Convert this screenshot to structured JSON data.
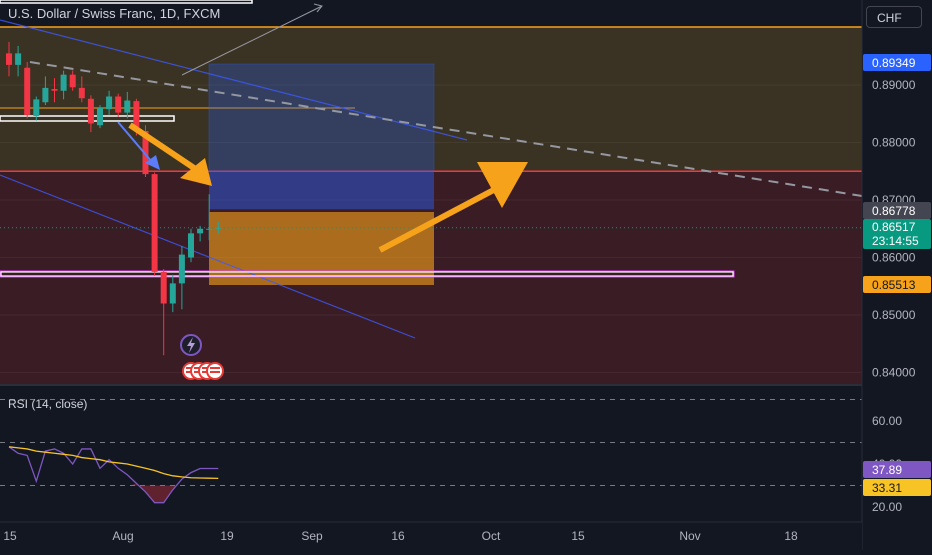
{
  "header": {
    "symbol_title": "U.S. Dollar / Swiss Franc, 1D, FXCM",
    "currency_button": "CHF"
  },
  "colors": {
    "background": "#131722",
    "upper_zone": "#3a3222",
    "lower_zone": "#3a1c24",
    "up_candle": "#26a69a",
    "down_candle": "#f23645",
    "current_price_tag": "#089981",
    "blue_tag": "#2962ff",
    "orange_tag": "#f7a21b",
    "arrow": "#f7a21b",
    "rsi_line": "#7e57c2",
    "rsi_ma": "#f7c325"
  },
  "chart_data": [
    {
      "type": "candlestick",
      "title": "U.S. Dollar / Swiss Franc, 1D, FXCM",
      "price_axis_ticks": [
        0.89,
        0.88,
        0.87,
        0.86,
        0.85,
        0.84
      ],
      "price_axis_tick_labels": [
        "0.89000",
        "0.88000",
        "0.87000",
        "0.86000",
        "0.85000",
        "0.84000"
      ],
      "ylim": [
        0.8375,
        0.9005
      ],
      "time_axis_labels": [
        "15",
        "Aug",
        "19",
        "Sep",
        "16",
        "Oct",
        "15",
        "Nov",
        "18"
      ],
      "price_tags": [
        {
          "label": "0.89349",
          "value": 0.89349,
          "color": "#2962ff"
        },
        {
          "label": "0.86778",
          "value": 0.86778,
          "color": "#434651"
        },
        {
          "label": "0.86517",
          "value": 0.86517,
          "color": "#089981",
          "countdown": "23:14:55"
        },
        {
          "label": "0.85513",
          "value": 0.85513,
          "color": "#f7a21b"
        }
      ],
      "candles": [
        {
          "o": 0.8955,
          "h": 0.8975,
          "l": 0.8915,
          "c": 0.8935
        },
        {
          "o": 0.8935,
          "h": 0.8968,
          "l": 0.8915,
          "c": 0.8955
        },
        {
          "o": 0.893,
          "h": 0.894,
          "l": 0.8842,
          "c": 0.8848
        },
        {
          "o": 0.8846,
          "h": 0.888,
          "l": 0.8838,
          "c": 0.8875
        },
        {
          "o": 0.887,
          "h": 0.8915,
          "l": 0.8865,
          "c": 0.8895
        },
        {
          "o": 0.8893,
          "h": 0.8912,
          "l": 0.887,
          "c": 0.889
        },
        {
          "o": 0.889,
          "h": 0.8925,
          "l": 0.8875,
          "c": 0.8918
        },
        {
          "o": 0.8918,
          "h": 0.8925,
          "l": 0.889,
          "c": 0.8896
        },
        {
          "o": 0.8895,
          "h": 0.8915,
          "l": 0.887,
          "c": 0.8877
        },
        {
          "o": 0.8876,
          "h": 0.8882,
          "l": 0.8818,
          "c": 0.8833
        },
        {
          "o": 0.883,
          "h": 0.8865,
          "l": 0.8825,
          "c": 0.886
        },
        {
          "o": 0.8858,
          "h": 0.889,
          "l": 0.8848,
          "c": 0.888
        },
        {
          "o": 0.888,
          "h": 0.8885,
          "l": 0.8845,
          "c": 0.8852
        },
        {
          "o": 0.8852,
          "h": 0.8888,
          "l": 0.8842,
          "c": 0.8873
        },
        {
          "o": 0.8872,
          "h": 0.8876,
          "l": 0.8812,
          "c": 0.8822
        },
        {
          "o": 0.882,
          "h": 0.883,
          "l": 0.874,
          "c": 0.8745
        },
        {
          "o": 0.8745,
          "h": 0.8748,
          "l": 0.8568,
          "c": 0.8575
        },
        {
          "o": 0.8575,
          "h": 0.858,
          "l": 0.843,
          "c": 0.852
        },
        {
          "o": 0.852,
          "h": 0.857,
          "l": 0.8505,
          "c": 0.8555
        },
        {
          "o": 0.8555,
          "h": 0.862,
          "l": 0.851,
          "c": 0.8605
        },
        {
          "o": 0.86,
          "h": 0.865,
          "l": 0.8592,
          "c": 0.8642
        },
        {
          "o": 0.8642,
          "h": 0.8655,
          "l": 0.8628,
          "c": 0.865
        },
        {
          "o": 0.865,
          "h": 0.871,
          "l": 0.863,
          "c": 0.865
        },
        {
          "o": 0.865,
          "h": 0.8662,
          "l": 0.8642,
          "c": 0.8652
        }
      ],
      "horizontal_levels": [
        0.875,
        0.89,
        0.8551
      ]
    },
    {
      "type": "line",
      "title": "RSI (14, close)",
      "ylim": [
        15,
        73
      ],
      "axis_ticks": [
        60,
        40,
        20
      ],
      "axis_tick_labels": [
        "60.00",
        "40.00",
        "20.00"
      ],
      "bands": [
        70,
        50,
        30
      ],
      "series": [
        {
          "name": "RSI",
          "value_label": "37.89",
          "color": "#7e57c2",
          "values": [
            48,
            45,
            44,
            32,
            46,
            47,
            45,
            40,
            47,
            47,
            38,
            42,
            38,
            35,
            31,
            27,
            22,
            22,
            28,
            33,
            36,
            37.89,
            37.89,
            37.89
          ]
        },
        {
          "name": "RSI MA",
          "value_label": "33.31",
          "color": "#f7c325",
          "values": [
            48,
            47.5,
            47,
            46,
            45.5,
            45,
            44.5,
            44,
            43,
            42.5,
            42,
            41,
            40.5,
            40,
            39,
            38,
            37,
            35.5,
            34.5,
            34,
            33.6,
            33.5,
            33.4,
            33.31
          ]
        }
      ]
    }
  ]
}
